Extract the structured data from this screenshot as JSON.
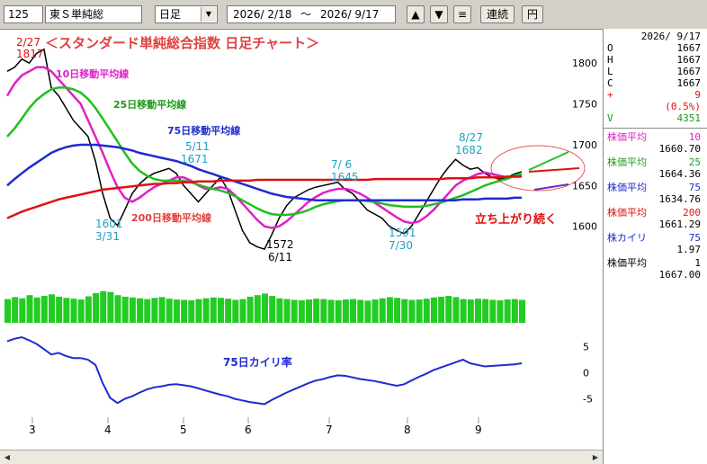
{
  "toolbar": {
    "code": "125",
    "name": "東Ｓ単純総",
    "period": "日足",
    "range_start": "2026/ 2/18",
    "range_sep": "～",
    "range_end": "2026/ 9/17",
    "up_label": "▲",
    "down_label": "▼",
    "menu_label": "≡",
    "continuous_label": "連続",
    "yen_label": "円"
  },
  "chart_data": {
    "type": "line",
    "title": "＜スタンダード単純総合指数  日足チャート＞",
    "x_tick_labels": [
      "3",
      "4",
      "5",
      "6",
      "7",
      "8",
      "9"
    ],
    "price_ylim": [
      1560,
      1830
    ],
    "price_ticks": [
      1600,
      1650,
      1700,
      1750,
      1800
    ],
    "series": [
      {
        "name": "",
        "color": "#000000",
        "values": [
          1790,
          1795,
          1805,
          1800,
          1812,
          1817,
          1770,
          1760,
          1745,
          1730,
          1720,
          1710,
          1680,
          1640,
          1610,
          1601,
          1620,
          1640,
          1652,
          1660,
          1665,
          1668,
          1671,
          1665,
          1650,
          1640,
          1630,
          1640,
          1650,
          1660,
          1645,
          1620,
          1595,
          1580,
          1575,
          1572,
          1590,
          1610,
          1625,
          1635,
          1640,
          1645,
          1648,
          1650,
          1652,
          1654,
          1645,
          1640,
          1630,
          1620,
          1615,
          1610,
          1600,
          1595,
          1591,
          1600,
          1615,
          1630,
          1645,
          1660,
          1672,
          1682,
          1675,
          1670,
          1672,
          1665,
          1660,
          1658,
          1660,
          1664,
          1667
        ]
      },
      {
        "name": "10日移動平均線",
        "color": "#e020c8",
        "values": [
          1760,
          1775,
          1785,
          1790,
          1795,
          1795,
          1790,
          1780,
          1770,
          1760,
          1750,
          1730,
          1710,
          1690,
          1668,
          1648,
          1635,
          1630,
          1635,
          1642,
          1648,
          1652,
          1656,
          1660,
          1660,
          1656,
          1650,
          1646,
          1646,
          1648,
          1646,
          1638,
          1628,
          1618,
          1608,
          1600,
          1598,
          1600,
          1606,
          1614,
          1622,
          1630,
          1636,
          1641,
          1644,
          1646,
          1646,
          1644,
          1640,
          1635,
          1629,
          1623,
          1617,
          1611,
          1606,
          1604,
          1606,
          1612,
          1620,
          1630,
          1640,
          1650,
          1656,
          1660,
          1664,
          1666,
          1664,
          1662,
          1660,
          1661,
          1661
        ]
      },
      {
        "name": "25日移動平均線",
        "color": "#20c020",
        "values": [
          1710,
          1720,
          1732,
          1745,
          1755,
          1762,
          1768,
          1770,
          1770,
          1768,
          1764,
          1756,
          1745,
          1732,
          1718,
          1704,
          1690,
          1677,
          1668,
          1662,
          1658,
          1656,
          1656,
          1656,
          1656,
          1654,
          1651,
          1648,
          1646,
          1644,
          1641,
          1637,
          1632,
          1627,
          1622,
          1618,
          1615,
          1614,
          1614,
          1615,
          1617,
          1620,
          1624,
          1627,
          1629,
          1631,
          1632,
          1632,
          1632,
          1631,
          1630,
          1628,
          1626,
          1625,
          1624,
          1624,
          1624,
          1625,
          1627,
          1629,
          1632,
          1635,
          1638,
          1642,
          1646,
          1650,
          1653,
          1656,
          1658,
          1662,
          1664
        ]
      },
      {
        "name": "75日移動平均線",
        "color": "#1e2bd0",
        "values": [
          1650,
          1658,
          1665,
          1672,
          1678,
          1684,
          1690,
          1694,
          1697,
          1699,
          1700,
          1700,
          1700,
          1699,
          1698,
          1697,
          1695,
          1693,
          1690,
          1688,
          1686,
          1684,
          1682,
          1680,
          1677,
          1674,
          1670,
          1667,
          1664,
          1661,
          1658,
          1655,
          1652,
          1649,
          1646,
          1643,
          1640,
          1638,
          1636,
          1635,
          1634,
          1633,
          1632,
          1632,
          1632,
          1632,
          1632,
          1632,
          1632,
          1632,
          1632,
          1632,
          1632,
          1632,
          1632,
          1632,
          1632,
          1632,
          1632,
          1632,
          1632,
          1632,
          1633,
          1633,
          1633,
          1634,
          1634,
          1634,
          1634,
          1635,
          1635
        ]
      },
      {
        "name": "200日移動平均線",
        "color": "#e01010",
        "values": [
          1610,
          1614,
          1618,
          1621,
          1624,
          1627,
          1630,
          1633,
          1635,
          1637,
          1639,
          1641,
          1643,
          1645,
          1646,
          1647,
          1648,
          1649,
          1650,
          1651,
          1652,
          1652,
          1653,
          1653,
          1654,
          1654,
          1655,
          1655,
          1655,
          1656,
          1656,
          1656,
          1656,
          1656,
          1657,
          1657,
          1657,
          1657,
          1657,
          1657,
          1657,
          1657,
          1657,
          1657,
          1657,
          1657,
          1657,
          1657,
          1657,
          1657,
          1658,
          1658,
          1658,
          1658,
          1658,
          1658,
          1658,
          1658,
          1658,
          1658,
          1659,
          1659,
          1659,
          1659,
          1660,
          1660,
          1660,
          1660,
          1661,
          1661,
          1661
        ]
      }
    ],
    "volume_values": [
      60,
      65,
      62,
      70,
      64,
      68,
      72,
      66,
      63,
      61,
      59,
      67,
      75,
      80,
      78,
      70,
      66,
      64,
      62,
      60,
      63,
      65,
      61,
      59,
      58,
      57,
      60,
      62,
      64,
      63,
      61,
      58,
      60,
      66,
      70,
      74,
      68,
      62,
      60,
      58,
      57,
      59,
      61,
      60,
      58,
      57,
      59,
      60,
      58,
      56,
      59,
      62,
      65,
      63,
      60,
      58,
      59,
      61,
      64,
      66,
      68,
      65,
      60,
      59,
      61,
      60,
      58,
      57,
      59,
      60,
      58
    ],
    "kairi": {
      "name": "75日カイリ率",
      "color": "#1e2bd0",
      "ylim": [
        -8,
        8
      ],
      "ticks": [
        -5,
        0,
        5
      ],
      "values": [
        6,
        6.5,
        6.8,
        6.2,
        5.5,
        4.5,
        3.5,
        3.8,
        3.2,
        2.8,
        2.8,
        2.5,
        1.5,
        -2,
        -4.8,
        -5.8,
        -5,
        -4.5,
        -3.8,
        -3.2,
        -2.8,
        -2.6,
        -2.3,
        -2.2,
        -2.4,
        -2.6,
        -3,
        -3.4,
        -3.8,
        -4.2,
        -4.5,
        -5,
        -5.3,
        -5.6,
        -5.8,
        -6,
        -5.2,
        -4.5,
        -3.8,
        -3.2,
        -2.6,
        -2,
        -1.5,
        -1.2,
        -0.8,
        -0.5,
        -0.6,
        -0.9,
        -1.2,
        -1.4,
        -1.6,
        -1.9,
        -2.2,
        -2.5,
        -2.2,
        -1.5,
        -0.8,
        -0.2,
        0.5,
        1,
        1.5,
        2,
        2.5,
        1.8,
        1.5,
        1.2,
        1.3,
        1.4,
        1.5,
        1.6,
        1.8
      ]
    },
    "annotations": {
      "a1_date": "2/27",
      "a1_value": "1817",
      "a2_value": "1601",
      "a2_date": "3/31",
      "a3_date": "5/11",
      "a3_value": "1671",
      "a4_value": "1572",
      "a4_date": "6/11",
      "a5_date": "7/ 6",
      "a5_value": "1645",
      "a6_value": "1591",
      "a6_date": "7/30",
      "a7_date": "8/27",
      "a7_value": "1682",
      "trend_note": "立ち上がり続く"
    }
  },
  "side": {
    "date": "2026/ 9/17",
    "ohlc": [
      {
        "k": "O",
        "v": "1667"
      },
      {
        "k": "H",
        "v": "1667"
      },
      {
        "k": "L",
        "v": "1667"
      },
      {
        "k": "C",
        "v": "1667"
      }
    ],
    "change_label": "+",
    "change": "9",
    "change_pct": "(0.5%)",
    "vol_label": "V",
    "volume": "4351",
    "ind": [
      {
        "label": "株価平均",
        "n": "10",
        "val": "1660.70",
        "color": "#e020c8"
      },
      {
        "label": "株価平均",
        "n": "25",
        "val": "1664.36",
        "color": "#20a020"
      },
      {
        "label": "株価平均",
        "n": "75",
        "val": "1634.76",
        "color": "#1e2bd0"
      },
      {
        "label": "株価平均",
        "n": "200",
        "val": "1661.29",
        "color": "#e01010"
      },
      {
        "label": "株カイリ",
        "n": "75",
        "val": "1.97",
        "color": "#1e2bd0"
      },
      {
        "label": "株価平均",
        "n": "1",
        "val": "1667.00",
        "color": "#000000"
      }
    ]
  },
  "colors": {
    "up": "#e01010",
    "green": "#1a9a1a",
    "blue": "#1e2bd0",
    "annot": "#20a0c0"
  }
}
